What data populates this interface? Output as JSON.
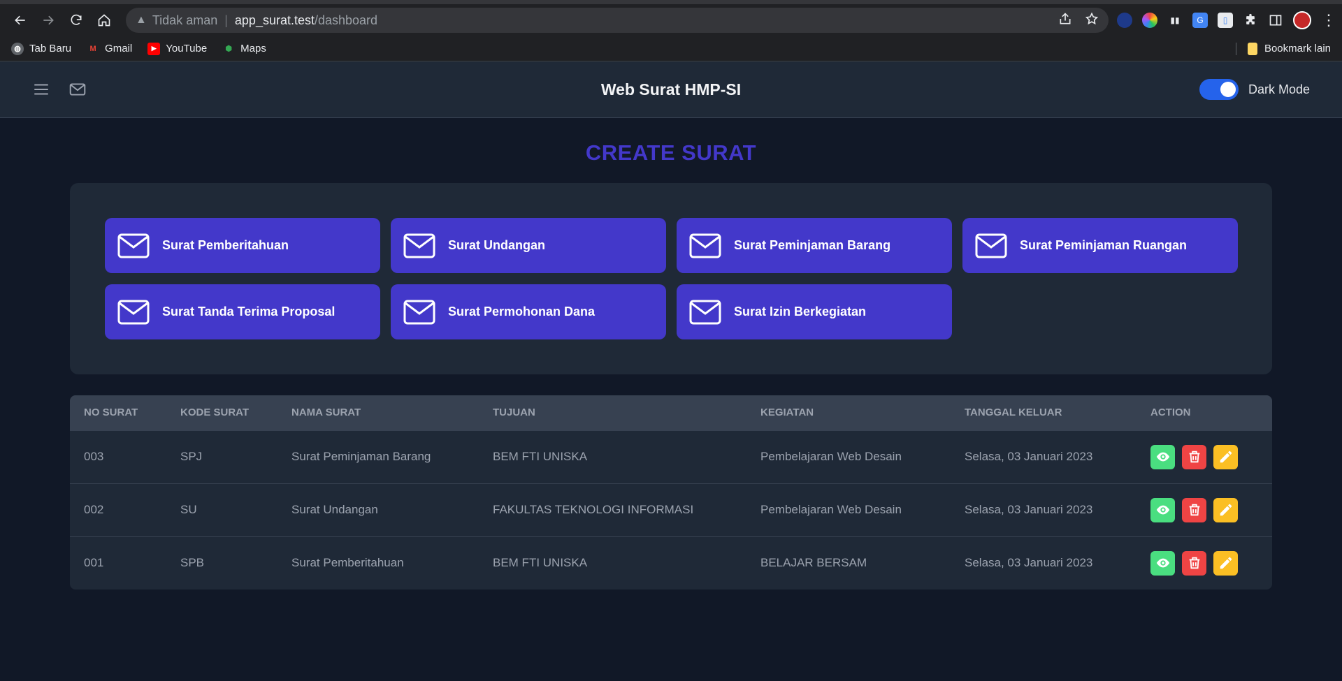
{
  "browser": {
    "insecure_label": "Tidak aman",
    "url_host": "app_surat.test",
    "url_path": "/dashboard",
    "bookmarks": [
      {
        "label": "Tab Baru",
        "icon": "globe-icon"
      },
      {
        "label": "Gmail",
        "icon": "gmail-icon"
      },
      {
        "label": "YouTube",
        "icon": "youtube-icon"
      },
      {
        "label": "Maps",
        "icon": "maps-icon"
      }
    ],
    "other_bookmarks": "Bookmark lain"
  },
  "header": {
    "title": "Web Surat HMP-SI",
    "dark_mode_label": "Dark Mode"
  },
  "main": {
    "title": "CREATE SURAT",
    "tiles": [
      "Surat Pemberitahuan",
      "Surat Undangan",
      "Surat Peminjaman Barang",
      "Surat Peminjaman Ruangan",
      "Surat Tanda Terima Proposal",
      "Surat Permohonan Dana",
      "Surat Izin Berkegiatan"
    ]
  },
  "table": {
    "headers": [
      "NO SURAT",
      "KODE SURAT",
      "NAMA SURAT",
      "TUJUAN",
      "KEGIATAN",
      "TANGGAL KELUAR",
      "ACTION"
    ],
    "rows": [
      [
        "003",
        "SPJ",
        "Surat Peminjaman Barang",
        "BEM FTI UNISKA",
        "Pembelajaran Web Desain",
        "Selasa, 03 Januari 2023"
      ],
      [
        "002",
        "SU",
        "Surat Undangan",
        "FAKULTAS TEKNOLOGI INFORMASI",
        "Pembelajaran Web Desain",
        "Selasa, 03 Januari 2023"
      ],
      [
        "001",
        "SPB",
        "Surat Pemberitahuan",
        "BEM FTI UNISKA",
        "BELAJAR BERSAM",
        "Selasa, 03 Januari 2023"
      ]
    ]
  },
  "colors": {
    "accent": "#4338ca",
    "view": "#4ade80",
    "delete": "#ef4444",
    "edit": "#fbbf24"
  }
}
